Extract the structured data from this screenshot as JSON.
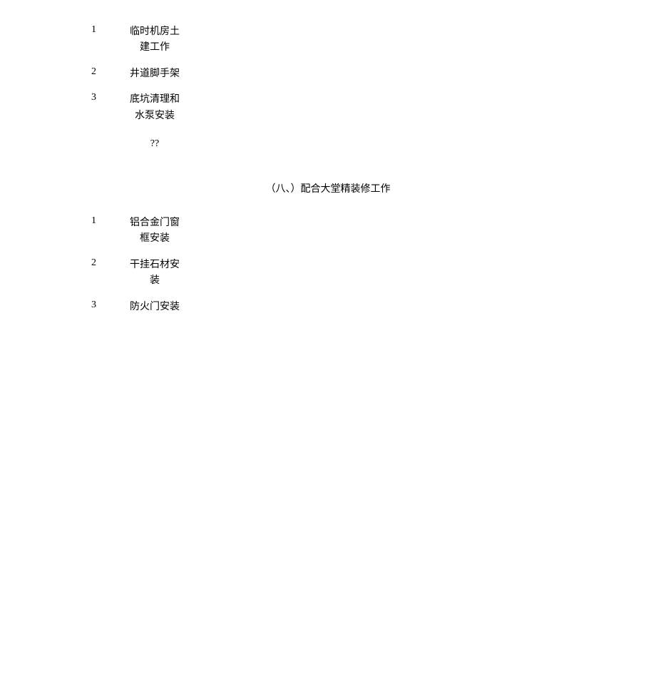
{
  "section1": {
    "items": [
      {
        "num": "1",
        "text": "临时机房土建工作"
      },
      {
        "num": "2",
        "text": "井道脚手架"
      },
      {
        "num": "3",
        "text": "底坑清理和水泵安装"
      }
    ],
    "extra": "??"
  },
  "heading": "（八、）配合大堂精装修工作",
  "section2": {
    "items": [
      {
        "num": "1",
        "text": "铝合金门窗框安装"
      },
      {
        "num": "2",
        "text": "干挂石材安装"
      },
      {
        "num": "3",
        "text": "防火门安装"
      }
    ]
  }
}
